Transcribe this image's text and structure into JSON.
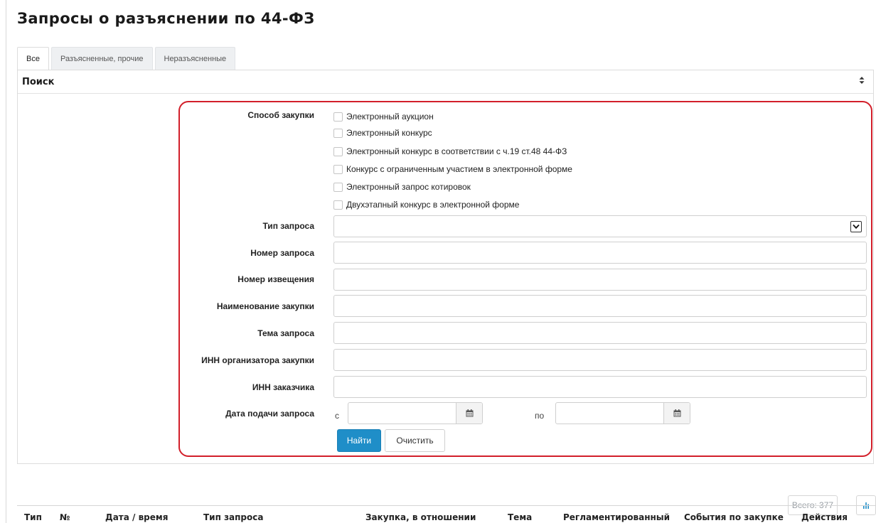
{
  "page": {
    "title": "Запросы о разъяснении по 44-ФЗ"
  },
  "tabs": [
    {
      "label": "Все",
      "active": true
    },
    {
      "label": "Разъясненные, прочие",
      "active": false
    },
    {
      "label": "Неразъясненные",
      "active": false
    }
  ],
  "search": {
    "title": "Поиск",
    "toggle_icon": "sort-toggle-icon",
    "method": {
      "label": "Способ закупки",
      "options": [
        {
          "label": "Электронный аукцион",
          "checked": false
        },
        {
          "label": "Электронный конкурс",
          "checked": false
        },
        {
          "label": "Электронный конкурс в соответствии с ч.19 ст.48 44-ФЗ",
          "checked": false
        },
        {
          "label": "Конкурс с ограниченным участием в электронной форме",
          "checked": false
        },
        {
          "label": "Электронный запрос котировок",
          "checked": false
        },
        {
          "label": "Двухэтапный конкурс в электронной форме",
          "checked": false
        }
      ]
    },
    "request_type": {
      "label": "Тип запроса",
      "value": ""
    },
    "request_number": {
      "label": "Номер запроса",
      "value": ""
    },
    "notice_number": {
      "label": "Номер извещения",
      "value": ""
    },
    "purchase_name": {
      "label": "Наименование закупки",
      "value": ""
    },
    "subject": {
      "label": "Тема запроса",
      "value": ""
    },
    "organizer_inn": {
      "label": "ИНН организатора закупки",
      "value": ""
    },
    "customer_inn": {
      "label": "ИНН заказчика",
      "value": ""
    },
    "date": {
      "label": "Дата подачи запроса",
      "from_prefix": "с",
      "to_prefix": "по",
      "from_value": "",
      "to_value": ""
    },
    "find_button": "Найти",
    "clear_button": "Очистить"
  },
  "results": {
    "total_label": "Всего: 377",
    "columns": [
      "Тип",
      "№",
      "Дата / время",
      "Тип запроса",
      "Закупка, в отношении",
      "Тема",
      "Регламентированный",
      "События по закупке",
      "Действия"
    ]
  },
  "colors": {
    "primary": "#1f8ec8",
    "highlight": "#d21f2a"
  }
}
